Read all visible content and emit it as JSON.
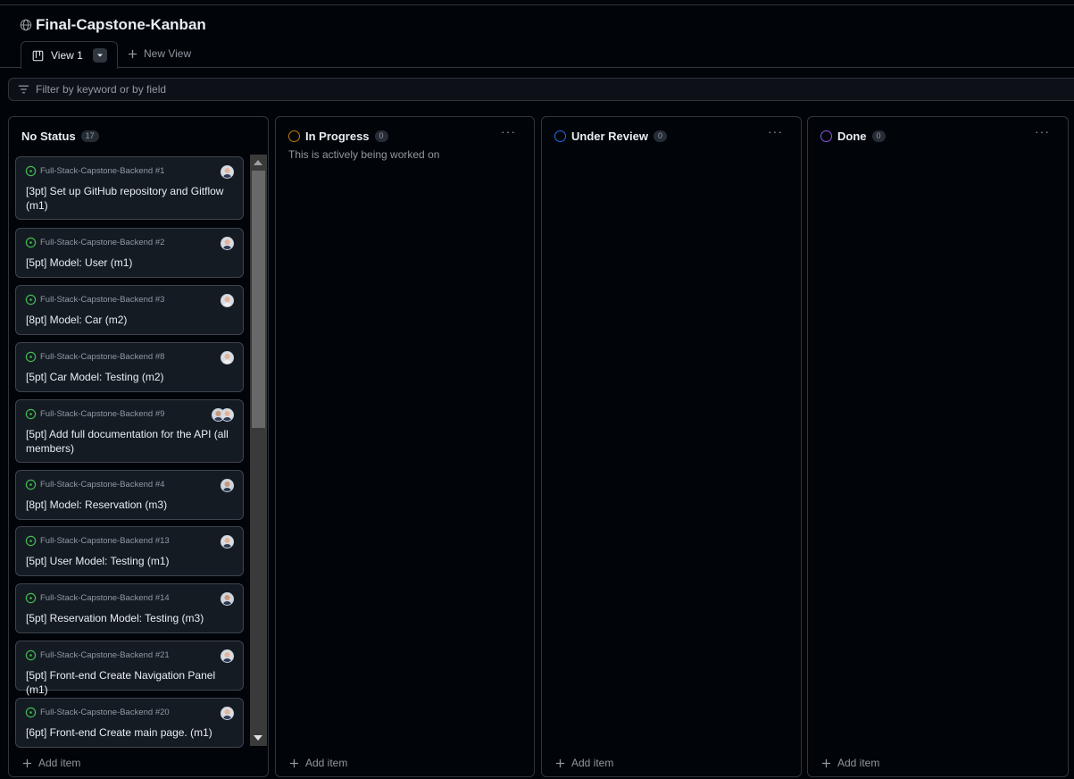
{
  "project": {
    "title": "Final-Capstone-Kanban",
    "icon": "globe-icon"
  },
  "tabs": {
    "active_view": "View 1",
    "new_view": "New View"
  },
  "filter": {
    "placeholder": "Filter by keyword or by field"
  },
  "columns": [
    {
      "name": "No Status",
      "count": "17",
      "status_color": "",
      "description": "",
      "add_item": "Add item",
      "cards": [
        {
          "repo": "Full-Stack-Capstone-Backend #1",
          "title": "[3pt] Set up GitHub repository and Gitflow (m1)"
        },
        {
          "repo": "Full-Stack-Capstone-Backend #2",
          "title": "[5pt] Model: User (m1)"
        },
        {
          "repo": "Full-Stack-Capstone-Backend #3",
          "title": "[8pt] Model: Car (m2)"
        },
        {
          "repo": "Full-Stack-Capstone-Backend #8",
          "title": "[5pt] Car Model: Testing (m2)"
        },
        {
          "repo": "Full-Stack-Capstone-Backend #9",
          "title": "[5pt] Add full documentation for the API (all members)"
        },
        {
          "repo": "Full-Stack-Capstone-Backend #4",
          "title": "[8pt] Model: Reservation (m3)"
        },
        {
          "repo": "Full-Stack-Capstone-Backend #13",
          "title": "[5pt] User Model: Testing (m1)"
        },
        {
          "repo": "Full-Stack-Capstone-Backend #14",
          "title": "[5pt] Reservation Model: Testing (m3)"
        },
        {
          "repo": "Full-Stack-Capstone-Backend #21",
          "title": "[5pt] Front-end Create Navigation Panel (m1)"
        },
        {
          "repo": "Full-Stack-Capstone-Backend #20",
          "title": "[6pt] Front-end Create main page. (m1)"
        }
      ]
    },
    {
      "name": "In Progress",
      "count": "0",
      "status_color": "#bb8009",
      "description": "This is actively being worked on",
      "add_item": "Add item"
    },
    {
      "name": "Under Review",
      "count": "0",
      "status_color": "#1f6feb",
      "description": "",
      "add_item": "Add item"
    },
    {
      "name": "Done",
      "count": "0",
      "status_color": "#8957e5",
      "description": "",
      "add_item": "Add item"
    }
  ],
  "colors": {
    "open_issue": "#3fb950",
    "border": "#30363d",
    "card_bg": "#151b23"
  }
}
